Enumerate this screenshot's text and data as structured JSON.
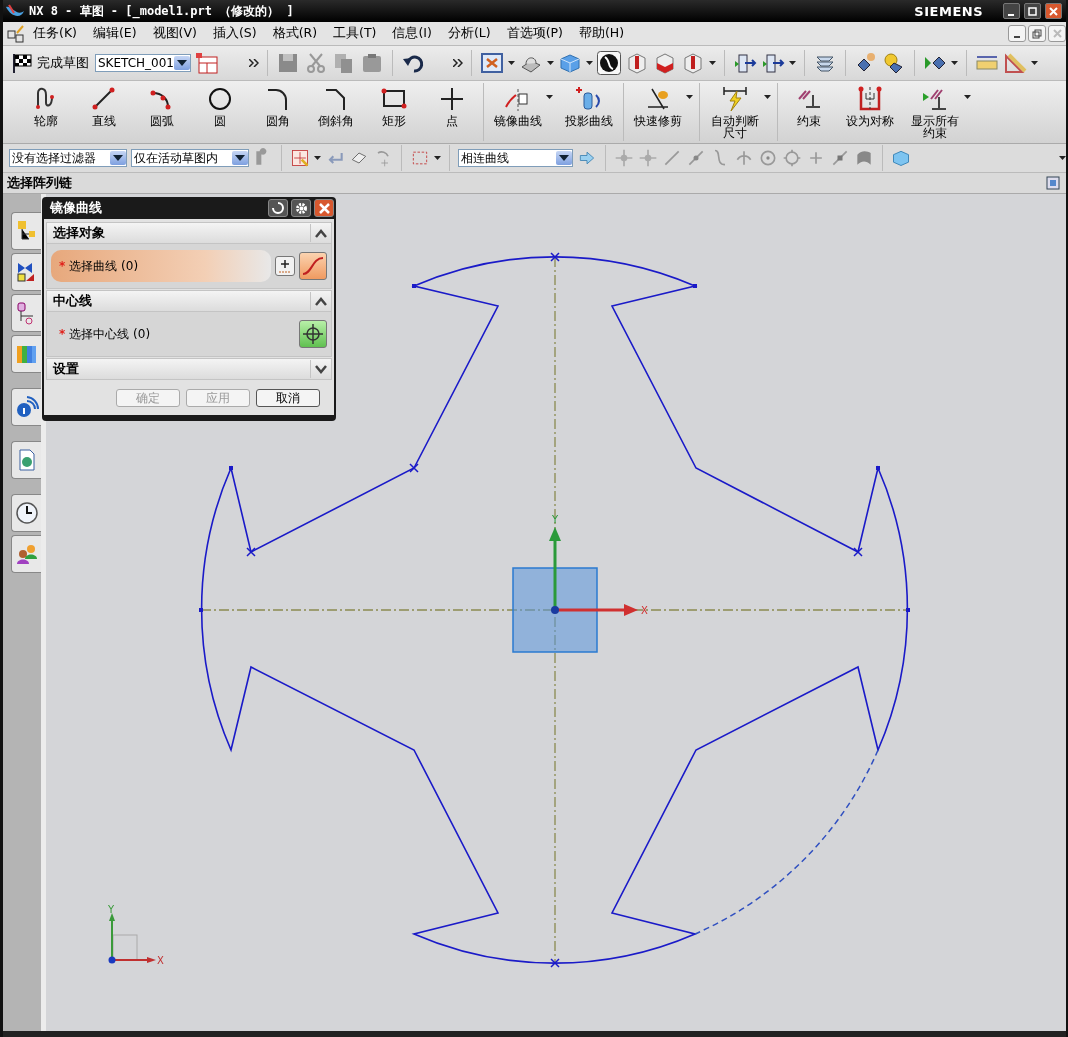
{
  "window": {
    "title": "NX 8 - 草图 - [_model1.prt （修改的） ]",
    "brand": "SIEMENS"
  },
  "menu": [
    "任务(K)",
    "编辑(E)",
    "视图(V)",
    "插入(S)",
    "格式(R)",
    "工具(T)",
    "信息(I)",
    "分析(L)",
    "首选项(P)",
    "帮助(H)"
  ],
  "sketch_toolbar": {
    "finish_label": "完成草图",
    "sketch_name": "SKETCH_001"
  },
  "sketch_tools": [
    {
      "label": "轮廓",
      "kind": "profile",
      "has_menu": false
    },
    {
      "label": "直线",
      "kind": "line",
      "has_menu": false
    },
    {
      "label": "圆弧",
      "kind": "arc",
      "has_menu": false
    },
    {
      "label": "圆",
      "kind": "circle",
      "has_menu": false
    },
    {
      "label": "圆角",
      "kind": "fillet",
      "has_menu": false
    },
    {
      "label": "倒斜角",
      "kind": "chamfer",
      "has_menu": false
    },
    {
      "label": "矩形",
      "kind": "rect",
      "has_menu": false
    },
    {
      "label": "点",
      "kind": "point",
      "has_menu": false
    },
    {
      "label": "镜像曲线",
      "kind": "mirror",
      "has_menu": true
    },
    {
      "label": "投影曲线",
      "kind": "project",
      "has_menu": false
    },
    {
      "label": "快速修剪",
      "kind": "trim",
      "has_menu": true
    },
    {
      "label": "自动判断尺寸",
      "kind": "dimension",
      "has_menu": true
    },
    {
      "label": "约束",
      "kind": "constraint",
      "has_menu": false
    },
    {
      "label": "设为对称",
      "kind": "symmetric",
      "has_menu": false
    },
    {
      "label": "显示所有约束",
      "kind": "showcon",
      "has_menu": true
    }
  ],
  "selection_bar": {
    "type_filter": "没有选择过滤器",
    "scope": "仅在活动草图内",
    "curve_rule": "相连曲线"
  },
  "cue_line": "选择阵列链",
  "dialog": {
    "title": "镜像曲线",
    "sections": [
      {
        "title": "选择对象",
        "expanded": true,
        "rows": [
          {
            "required_mark": "*",
            "label": "选择曲线 (0)",
            "selected": true,
            "kind": "curve"
          }
        ]
      },
      {
        "title": "中心线",
        "expanded": true,
        "rows": [
          {
            "required_mark": "*",
            "label": "选择中心线 (0)",
            "selected": false,
            "kind": "centerline"
          }
        ]
      },
      {
        "title": "设置",
        "expanded": false
      }
    ],
    "buttons": [
      {
        "label": "确定",
        "disabled": true
      },
      {
        "label": "应用",
        "disabled": true
      },
      {
        "label": "取消",
        "disabled": false
      }
    ]
  },
  "canvas": {
    "x_label": "X",
    "y_label": "Y",
    "triad_x_label": "X",
    "triad_y_label": "Y"
  }
}
